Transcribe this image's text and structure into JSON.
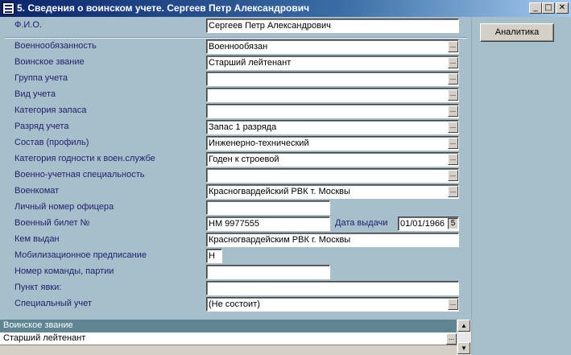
{
  "window": {
    "title": "5. Сведения о воинском учете. Сергеев Петр Александрович",
    "minimize_glyph": "_",
    "maximize_glyph": "□",
    "close_glyph": "✕"
  },
  "side": {
    "analytics_label": "Аналитика"
  },
  "form": {
    "fio": {
      "label": "Ф.И.О.",
      "value": "Сергеев Петр Александрович"
    },
    "fields": [
      {
        "label": "Военнообязанность",
        "value": "Военнообязан"
      },
      {
        "label": "Воинское звание",
        "value": "Старший лейтенант"
      },
      {
        "label": "Группа учета",
        "value": ""
      },
      {
        "label": "Вид учета",
        "value": ""
      },
      {
        "label": "Категория запаса",
        "value": ""
      },
      {
        "label": "Разряд учета",
        "value": "Запас 1 разряда"
      },
      {
        "label": "Состав (профиль)",
        "value": "Инженерно-технический"
      },
      {
        "label": "Категория годности к воен.службе",
        "value": "Годен к строевой"
      },
      {
        "label": "Военно-учетная специальность",
        "value": ""
      },
      {
        "label": "Военкомат",
        "value": "Красногвардейский РВК т. Москвы"
      },
      {
        "label": "Личный номер офицера",
        "value": ""
      },
      {
        "label": "Военный билет №",
        "value": "НМ 9977555"
      },
      {
        "label": "Кем выдан",
        "value": "Красногвардейским РВК г. Москвы"
      },
      {
        "label": "Мобилизационное предписание",
        "value": "Н"
      },
      {
        "label": "Номер команды, партии",
        "value": ""
      },
      {
        "label": "Пункт явки:",
        "value": ""
      },
      {
        "label": "Специальный учет",
        "value": "(Не состоит)"
      }
    ],
    "issue_date": {
      "label": "Дата выдачи",
      "value": "01/01/1966",
      "picker_glyph": "5"
    },
    "ellipsis": "..."
  },
  "grid": {
    "header": "Воинское звание",
    "row": "Старший лейтенант",
    "scroll_up": "▲",
    "scroll_down": "▼"
  }
}
